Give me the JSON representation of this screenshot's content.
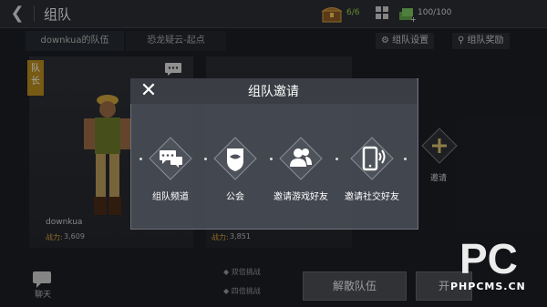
{
  "header": {
    "title": "组队",
    "chest_count": "6/6",
    "energy": "100/100"
  },
  "team_bar": {
    "team_name": "downkua的队伍",
    "stage": "恐龙疑云-起点",
    "settings_label": "组队设置",
    "rewards_label": "组队奖励"
  },
  "members": {
    "leader_badge": "队长",
    "player_name": "downkua",
    "power_label": "战力:",
    "power1": "3,609",
    "power2": "3,851"
  },
  "chat_label": "聊天",
  "checks": {
    "row1": "双倍挑战",
    "row2": "四倍挑战"
  },
  "buttons": {
    "disband": "解散队伍",
    "right_partial": "开"
  },
  "invite_right_label": "邀请",
  "modal": {
    "title": "组队邀请",
    "options": [
      "组队频道",
      "公会",
      "邀请游戏好友",
      "邀请社交好友"
    ]
  },
  "watermark": {
    "logo": "PC",
    "text": "PHPCMS.CN"
  },
  "colors": {
    "accent_gold": "#b78a1e",
    "power_label": "#e0a040",
    "chest_green": "#9dd34a"
  }
}
